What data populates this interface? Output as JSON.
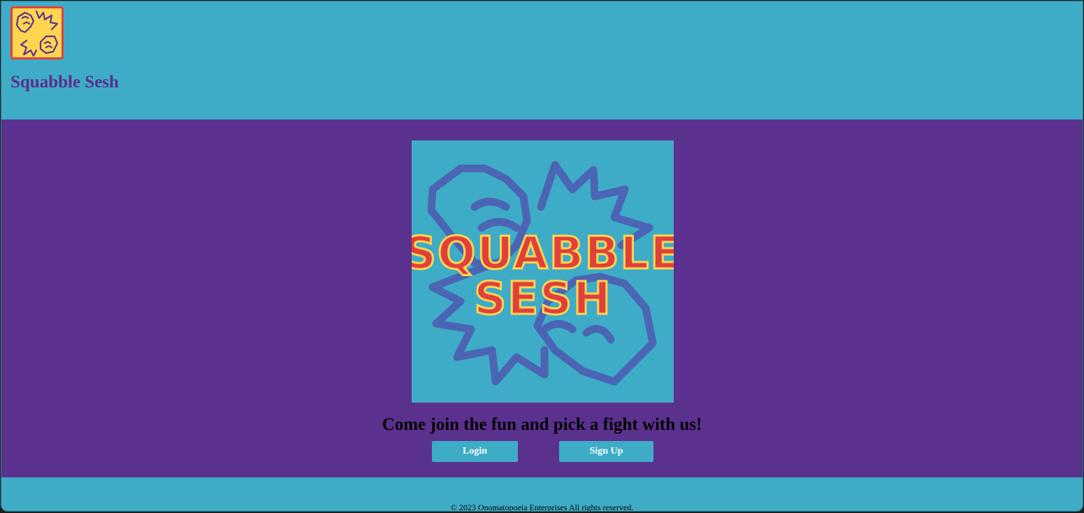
{
  "header": {
    "site_title": "Squabble Sesh",
    "logo_icon": "fighting-fists-icon"
  },
  "hero": {
    "logo_line1": "SQUABBLE",
    "logo_line2": "SESH",
    "logo_icon": "fighting-fists-icon",
    "tagline": "Come join the fun and pick a fight with us!"
  },
  "actions": {
    "login_label": "Login",
    "signup_label": "Sign Up"
  },
  "footer": {
    "copyright": "© 2023 Onomatopoeia Enterprises All rights reserved."
  },
  "colors": {
    "header_bg": "#3eacc7",
    "main_bg": "#5b318f",
    "title_color": "#5b2d8e",
    "logo_red": "#e0413a",
    "logo_yellow": "#fdd54f"
  }
}
